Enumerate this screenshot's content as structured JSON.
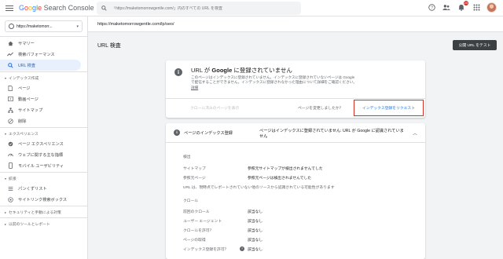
{
  "app": {
    "logo_g": "Google",
    "logo_rest": " Search Console",
    "search_placeholder": "「https://maketomorrowgentle.com/」内のすべての URL を検査",
    "notification_count": "23"
  },
  "sidebar": {
    "property": "https://maketomorr...",
    "items": [
      {
        "label": "サマリー",
        "icon": "home-icon"
      },
      {
        "label": "検索パフォーマンス",
        "icon": "trend-icon"
      },
      {
        "label": "URL 検査",
        "icon": "search-icon",
        "active": true
      }
    ],
    "index_head": "インデックス作成",
    "index_items": [
      {
        "label": "ページ",
        "icon": "pages-icon"
      },
      {
        "label": "動画ページ",
        "icon": "video-icon"
      },
      {
        "label": "サイトマップ",
        "icon": "sitemap-icon"
      },
      {
        "label": "削除",
        "icon": "remove-icon"
      }
    ],
    "experience_head": "エクスペリエンス",
    "experience_items": [
      {
        "label": "ページ エクスペリエンス",
        "icon": "page-experience-icon"
      },
      {
        "label": "ウェブに関する主な指標",
        "icon": "gauge-icon"
      },
      {
        "label": "モバイル ユーザビリティ",
        "icon": "mobile-icon"
      }
    ],
    "enhance_head": "拡張",
    "enhance_items": [
      {
        "label": "パンくずリスト",
        "icon": "breadcrumb-icon"
      },
      {
        "label": "サイトリンク検索ボックス",
        "icon": "sitelinks-icon"
      }
    ],
    "security_head": "セキュリティと手動による対策",
    "legacy_head": "以前のツールとレポート"
  },
  "main": {
    "inspected_url": "https://maketomorrowgentle.com/lp/seo/",
    "page_title": "URL 検査",
    "test_live_label": "公開 URL をテスト",
    "status_card": {
      "title_pre": "URL が ",
      "title_bold": "Google",
      "title_post": " に登録されていません",
      "desc": "このページはインデックスに登録されていません。インデックスに登録されていないページは Google で配信することができません。インデックスに登録されなかった理由について詳細をご確認ください。",
      "desc_link": "詳細",
      "crawl_link": "クロール済みのページを表示",
      "changed_q": "ページを変更しましたか？",
      "request_label": "インデックス登録をリクエスト"
    },
    "detail_card": {
      "title": "ページのインデックス登録",
      "status": "ページはインデックスに登録されていません: URL が Google に認識されていません",
      "discovery_title": "検出",
      "discovery_rows": [
        {
          "label": "サイトマップ",
          "value": "参照元サイトマップが検出されませんでした"
        },
        {
          "label": "参照元ページ",
          "value": "参照元ページは検出されませんでした"
        }
      ],
      "discovery_note": "URL は、現時点でレポートされていない他のソースから認識されている可能性があります",
      "crawl_title": "クロール",
      "crawl_rows": [
        {
          "label": "前回のクロール",
          "value": "該当なし"
        },
        {
          "label": "ユーザー エージェント",
          "value": "該当なし"
        },
        {
          "label": "クロールを許可？",
          "value": "該当なし"
        },
        {
          "label": "ページの取得",
          "value": "該当なし"
        },
        {
          "label": "インデックス登録を許可？",
          "value": "該当なし",
          "help": true
        }
      ]
    }
  },
  "colors": {
    "accent": "#1a73e8",
    "highlight_border": "#d93025",
    "active_bg": "#e8f0fe"
  }
}
